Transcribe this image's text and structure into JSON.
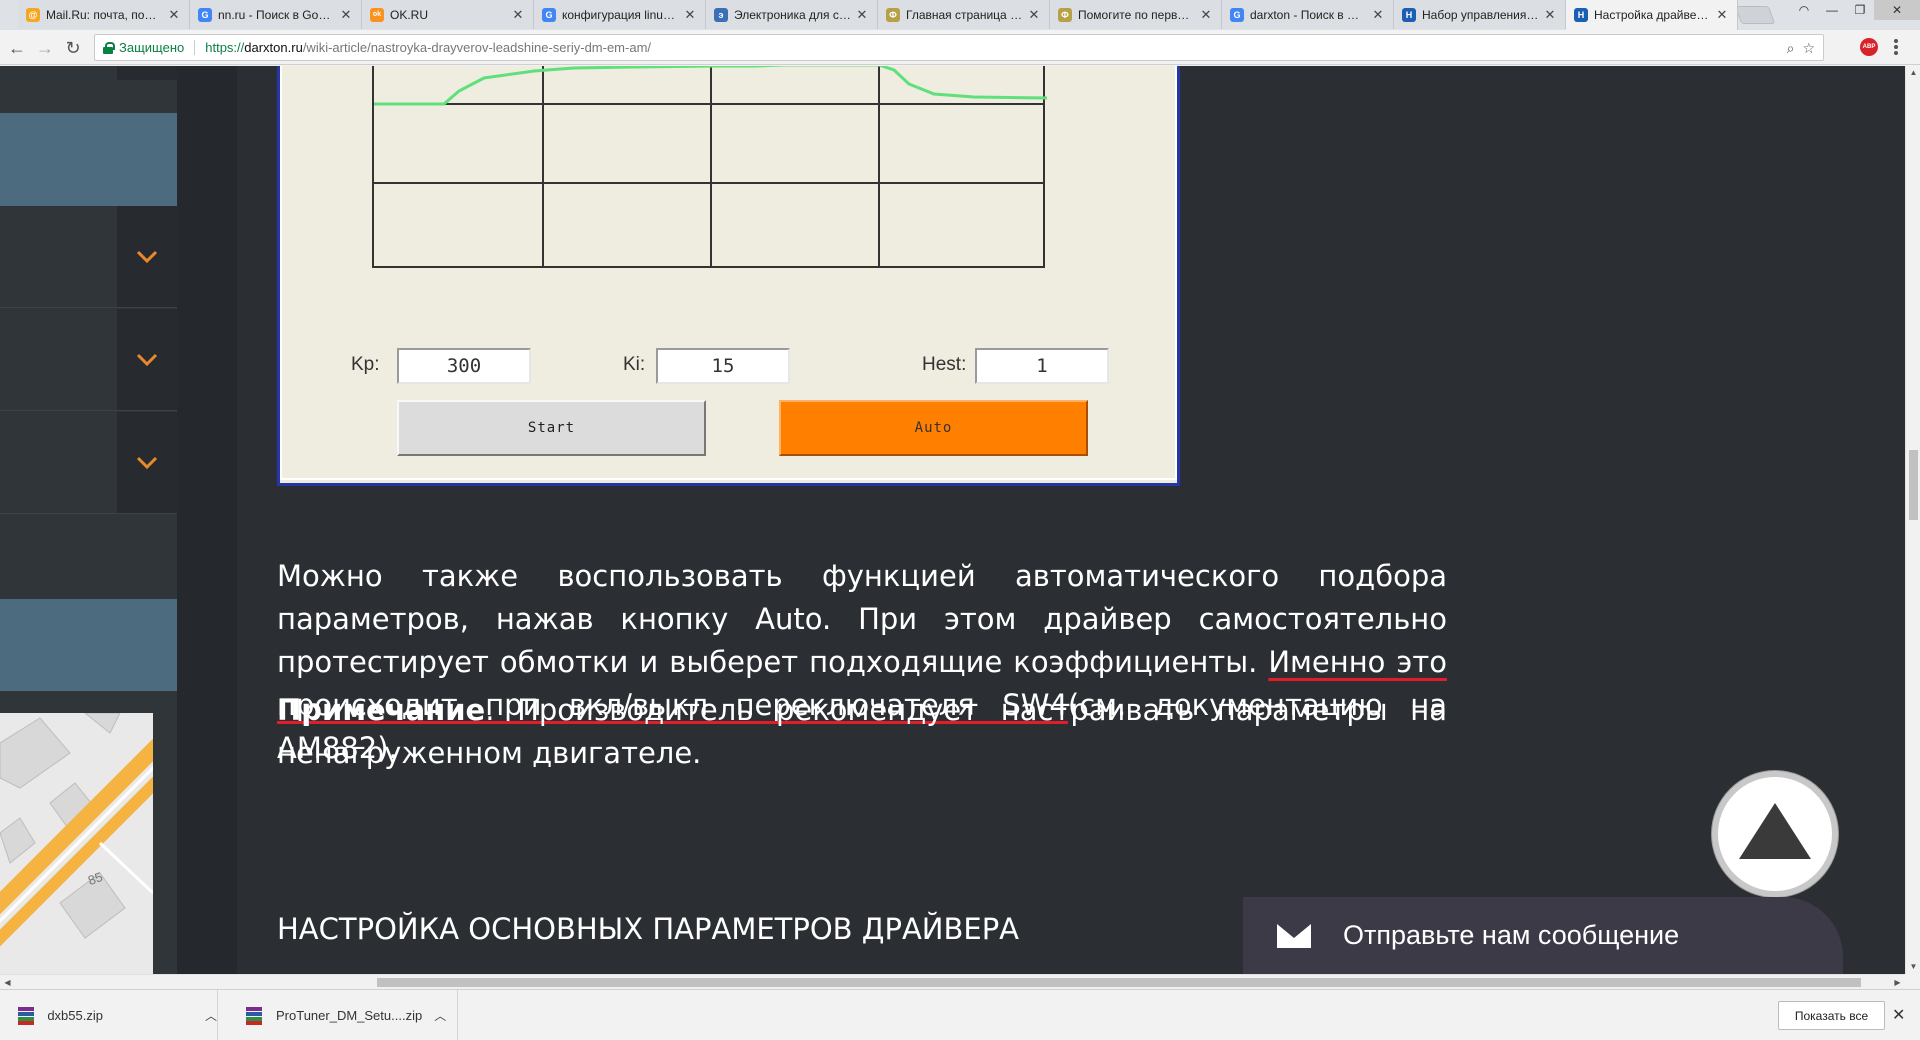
{
  "browser": {
    "tabs": [
      {
        "title": "Mail.Ru: почта, поиск в интернете",
        "favicon": "mailru-icon",
        "color": "#f5a623",
        "letter": "@"
      },
      {
        "title": "nn.ru - Поиск в Google",
        "favicon": "google-icon",
        "color": "#4285f4",
        "letter": "G"
      },
      {
        "title": "OK.RU",
        "favicon": "ok-icon",
        "color": "#f7931e",
        "letter": "ok"
      },
      {
        "title": "конфигурация linuxCNC",
        "favicon": "google-icon",
        "color": "#4285f4",
        "letter": "G"
      },
      {
        "title": "Электроника для станков",
        "favicon": "site-icon",
        "color": "#3b6fb6",
        "letter": "э"
      },
      {
        "title": "Главная страница - Форум",
        "favicon": "forum-icon",
        "color": "#b8a048",
        "letter": "Ф"
      },
      {
        "title": "Помогите по первой настройке",
        "favicon": "forum-icon",
        "color": "#b8a048",
        "letter": "Ф"
      },
      {
        "title": "darxton - Поиск в Google",
        "favicon": "google-icon",
        "color": "#4285f4",
        "letter": "G"
      },
      {
        "title": "Набор управления станком",
        "favicon": "site-icon",
        "color": "#1a5fb4",
        "letter": "Н"
      },
      {
        "title": "Настройка драйверов Leadshine",
        "favicon": "site-icon",
        "color": "#1a5fb4",
        "letter": "Н",
        "active": true
      }
    ],
    "address": {
      "secure_label": "Защищено",
      "scheme": "https://",
      "host": "darxton.ru",
      "path": "/wiki-article/nastroyka-drayverov-leadshine-seriy-dm-em-am/"
    },
    "abp_label": "ABP"
  },
  "tuner": {
    "kp_label": "Kp:",
    "kp_value": "300",
    "ki_label": "Ki:",
    "ki_value": "15",
    "hest_label": "Hest:",
    "hest_value": "1",
    "start_label": "Start",
    "auto_label": "Auto"
  },
  "article": {
    "para1_part1": "Можно также воспользовать функцией автоматического подбора параметров, нажав кнопку Auto. При этом драйвер самостоятельно протестирует обмотки и выберет подходящие коэффициенты. ",
    "para1_underlined": "Именно это происходит при вкл/выкл переключателя SW4",
    "para1_part2": "(см. документацию на АМ882).",
    "note_bold": "Примечание",
    "note_text": ". Производитель рекомендует настраивать параметры на ненагруженном двигателе.",
    "heading": "НАСТРОЙКА ОСНОВНЫХ ПАРАМЕТРОВ ДРАЙВЕРА"
  },
  "map_label": "85",
  "chat": {
    "label": "Отправьте нам сообщение"
  },
  "downloads": {
    "items": [
      {
        "name": "dxb55.zip"
      },
      {
        "name": "ProTuner_DM_Setu....zip"
      }
    ],
    "show_all": "Показать все"
  },
  "colors": {
    "accent_orange": "#ff8000",
    "underline_red": "#e11d2a",
    "sidebar_blue": "#4d6b7e",
    "chevron_orange": "#e8892b",
    "curve_green": "#5fe07a"
  }
}
